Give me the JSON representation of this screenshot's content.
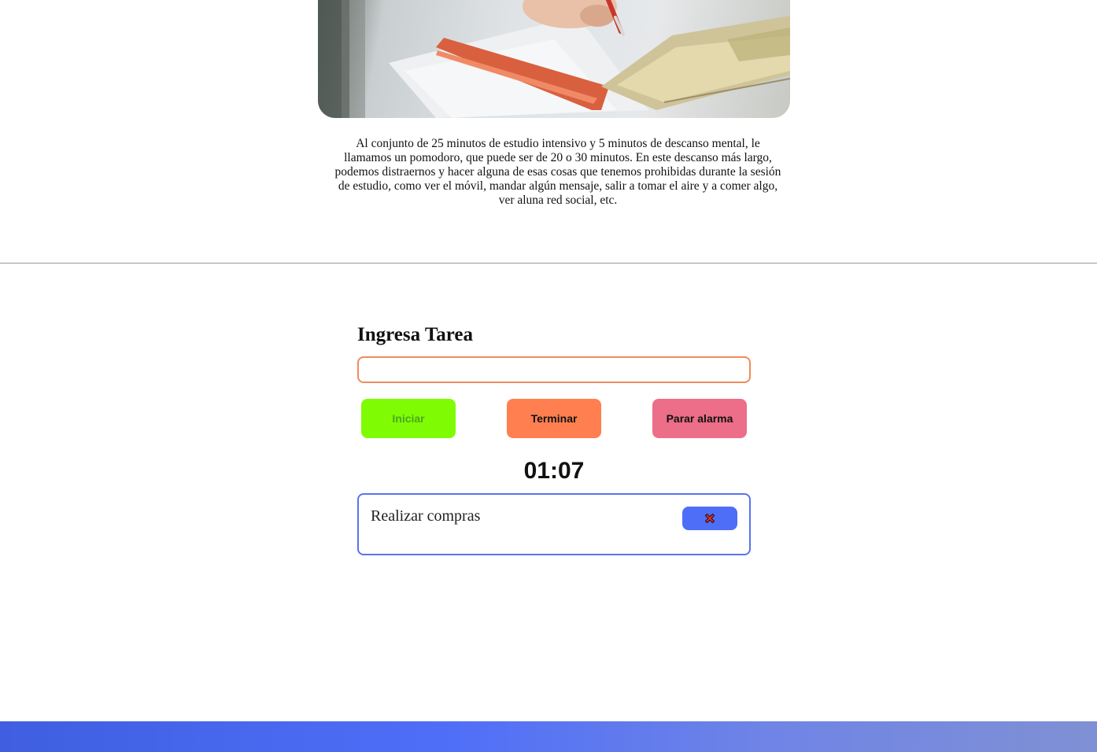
{
  "intro": {
    "paragraph": "Al conjunto de 25 minutos de estudio intensivo y 5 minutos de descanso mental, le llamamos un pomodoro, que puede ser de 20 o 30 minutos. En este descanso más largo, podemos distraernos y hacer alguna de esas cosas que tenemos prohibidas durante la sesión de estudio, como ver el móvil, mandar algún mensaje, salir a tomar el aire y a comer algo, ver aluna red social, etc."
  },
  "task_form": {
    "title": "Ingresa Tarea",
    "input_value": "",
    "input_placeholder": ""
  },
  "buttons": {
    "start_label": "Iniciar",
    "end_label": "Terminar",
    "stop_alarm_label": "Parar alarma"
  },
  "timer": {
    "display": "01:07"
  },
  "tasks": [
    {
      "label": "Realizar compras",
      "delete_icon": "cross-mark-icon"
    }
  ],
  "colors": {
    "start_button": "#7ffc03",
    "end_button": "#ff7f50",
    "stop_alarm_button": "#ec6e88",
    "input_border": "#f08a5d",
    "task_border": "#5a72f0",
    "delete_button": "#4f6ef7",
    "footer_gradient_start": "#3f5fe0",
    "footer_gradient_end": "#8090d4"
  }
}
